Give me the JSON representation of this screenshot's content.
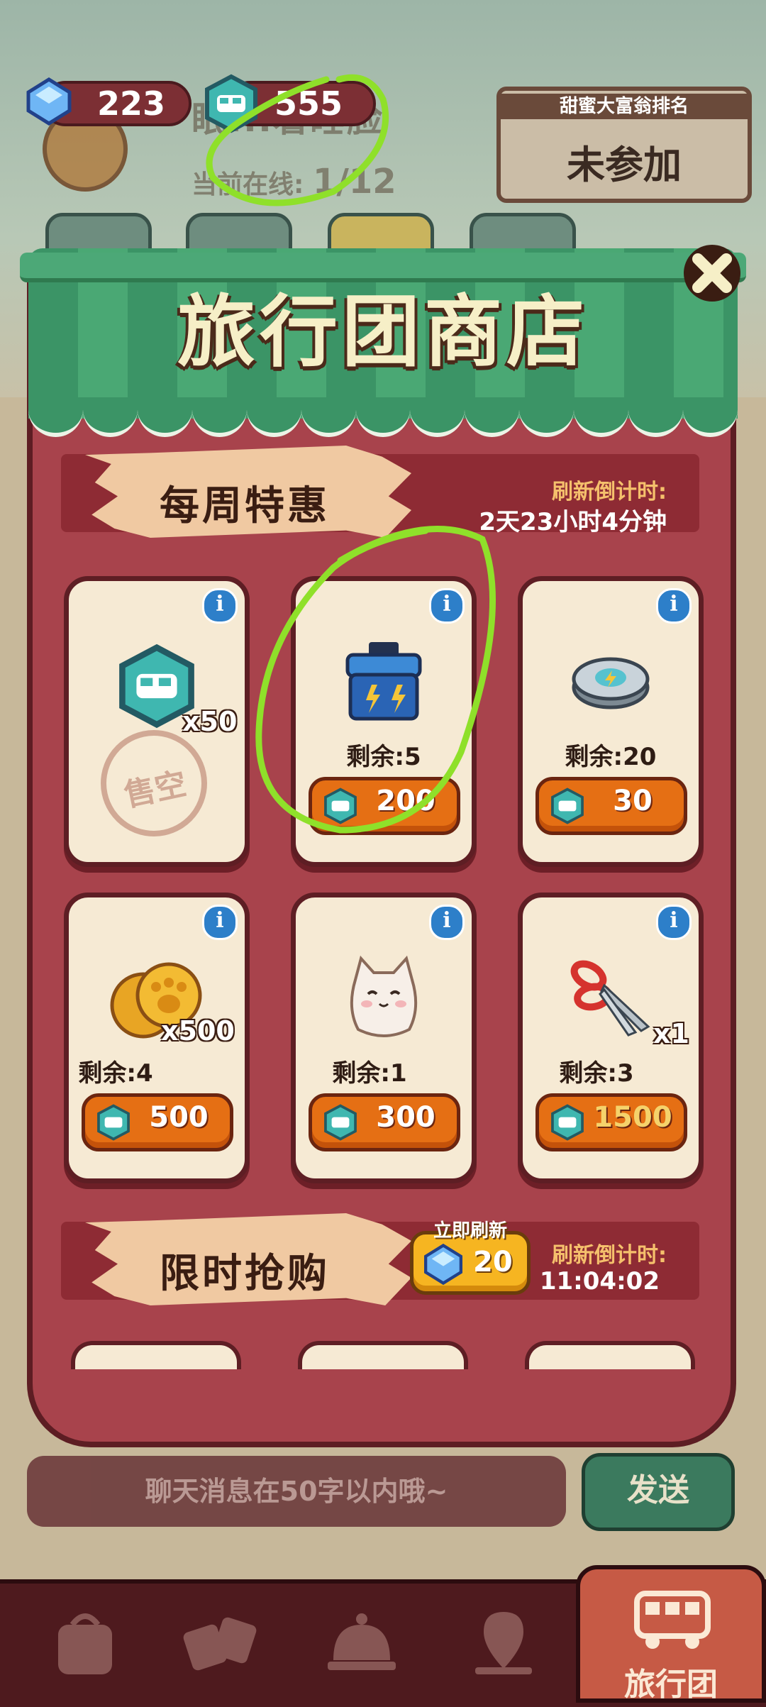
{
  "hud": {
    "gems": "223",
    "coins": "555",
    "room_name": "眠...着睡脸",
    "online_label": "当前在线:",
    "online_value": "1/12"
  },
  "leaderboard": {
    "title": "甜蜜大富翁排名",
    "value": "未参加"
  },
  "shop": {
    "title": "旅行团商店",
    "weekly": {
      "title": "每周特惠",
      "refresh_label": "刷新倒计时:",
      "refresh_value": "2天23小时4分钟"
    },
    "items": [
      {
        "icon": "bus-token-icon",
        "qty": "x50",
        "sold_out": "售空"
      },
      {
        "icon": "blue-supply-box-icon",
        "remain": "剩余:5",
        "price": "200"
      },
      {
        "icon": "lightning-disc-icon",
        "remain": "剩余:20",
        "price": "30"
      },
      {
        "icon": "paw-cookie-icon",
        "qty": "x500",
        "remain": "剩余:4",
        "price": "500"
      },
      {
        "icon": "lucky-cat-icon",
        "remain": "剩余:1",
        "price": "300"
      },
      {
        "icon": "scissors-icon",
        "qty": "x1",
        "remain": "剩余:3",
        "price": "1500"
      }
    ],
    "flash": {
      "title": "限时抢购",
      "refresh_now_label": "立即刷新",
      "refresh_now_cost": "20",
      "refresh_label": "刷新倒计时:",
      "refresh_value": "11:04:02"
    }
  },
  "chat": {
    "placeholder": "聊天消息在50字以内哦~",
    "send_label": "发送"
  },
  "nav": {
    "active_label": "旅行团"
  },
  "colors": {
    "coin_teal": "#3fb7b0",
    "buy_orange": "#e56f14",
    "panel_red": "#a8434c",
    "awning_green": "#3b9466",
    "scribble": "#8fe02a"
  }
}
